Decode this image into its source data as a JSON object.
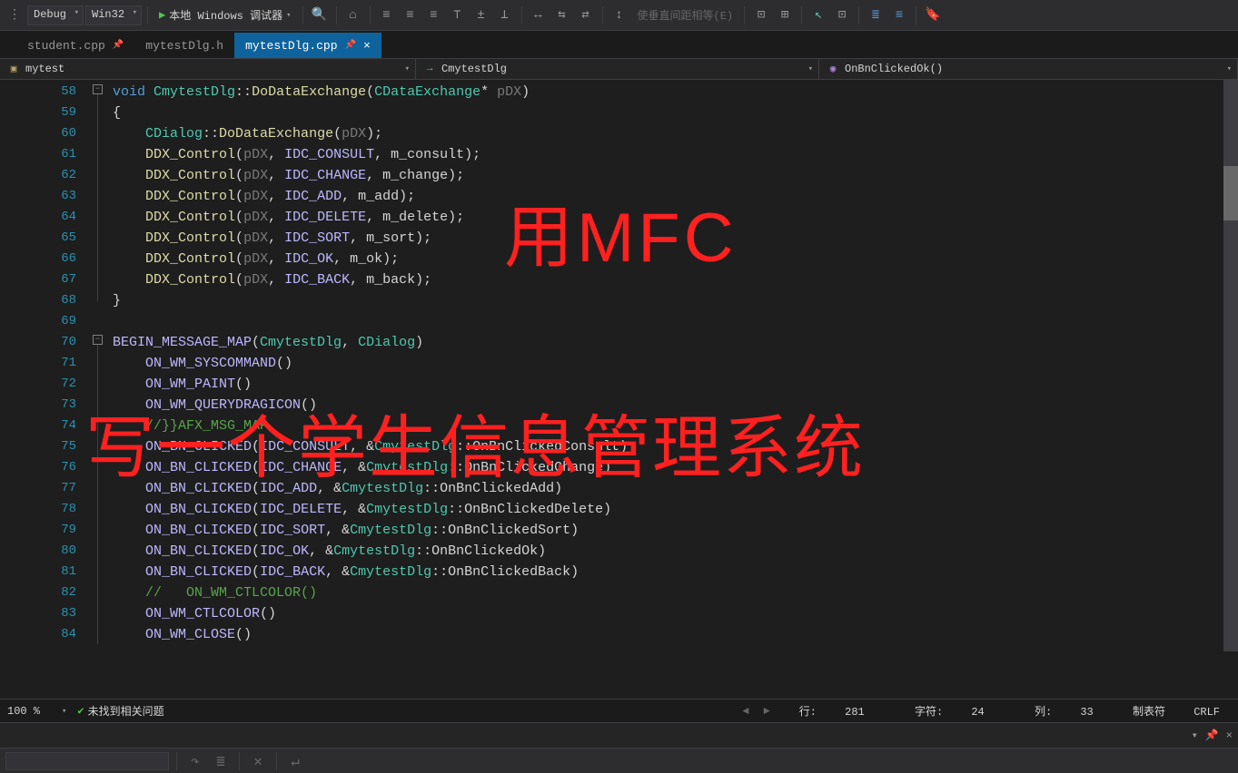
{
  "toolbar": {
    "config": "Debug",
    "platform": "Win32",
    "run_label": "本地 Windows 调试器",
    "disabled_label": "使垂直间距相等(E)"
  },
  "tabs": [
    {
      "label": "student.cpp",
      "active": false,
      "pinned": true
    },
    {
      "label": "mytestDlg.h",
      "active": false,
      "pinned": false
    },
    {
      "label": "mytestDlg.cpp",
      "active": true,
      "pinned": true
    }
  ],
  "context": {
    "project": "mytest",
    "class": "CmytestDlg",
    "function": "OnBnClickedOk()"
  },
  "line_numbers": [
    "58",
    "59",
    "60",
    "61",
    "62",
    "63",
    "64",
    "65",
    "66",
    "67",
    "68",
    "69",
    "70",
    "71",
    "72",
    "73",
    "74",
    "75",
    "76",
    "77",
    "78",
    "79",
    "80",
    "81",
    "82",
    "83",
    "84"
  ],
  "code_lines": [
    {
      "pre": "",
      "html": "<span class='k-blue'>void</span> <span class='k-type'>CmytestDlg</span><span class='k-white'>::</span><span class='k-fn'>DoDataExchange</span><span class='k-white'>(</span><span class='k-type'>CDataExchange</span><span class='k-white'>* </span><span class='k-gray'>pDX</span><span class='k-white'>)</span>"
    },
    {
      "pre": "",
      "html": "<span class='k-white'>{</span>"
    },
    {
      "pre": "    ",
      "html": "<span class='k-type'>CDialog</span><span class='k-white'>::</span><span class='k-fn'>DoDataExchange</span><span class='k-white'>(</span><span class='k-gray'>pDX</span><span class='k-white'>);</span>"
    },
    {
      "pre": "    ",
      "html": "<span class='k-fn'>DDX_Control</span><span class='k-white'>(</span><span class='k-gray'>pDX</span><span class='k-white'>, </span><span class='k-macro'>IDC_CONSULT</span><span class='k-white'>, m_consult);</span>"
    },
    {
      "pre": "    ",
      "html": "<span class='k-fn'>DDX_Control</span><span class='k-white'>(</span><span class='k-gray'>pDX</span><span class='k-white'>, </span><span class='k-macro'>IDC_CHANGE</span><span class='k-white'>, m_change);</span>"
    },
    {
      "pre": "    ",
      "html": "<span class='k-fn'>DDX_Control</span><span class='k-white'>(</span><span class='k-gray'>pDX</span><span class='k-white'>, </span><span class='k-macro'>IDC_ADD</span><span class='k-white'>, m_add);</span>"
    },
    {
      "pre": "    ",
      "html": "<span class='k-fn'>DDX_Control</span><span class='k-white'>(</span><span class='k-gray'>pDX</span><span class='k-white'>, </span><span class='k-macro'>IDC_DELETE</span><span class='k-white'>, m_delete);</span>"
    },
    {
      "pre": "    ",
      "html": "<span class='k-fn'>DDX_Control</span><span class='k-white'>(</span><span class='k-gray'>pDX</span><span class='k-white'>, </span><span class='k-macro'>IDC_SORT</span><span class='k-white'>, m_sort);</span>"
    },
    {
      "pre": "    ",
      "html": "<span class='k-fn'>DDX_Control</span><span class='k-white'>(</span><span class='k-gray'>pDX</span><span class='k-white'>, </span><span class='k-macro'>IDC_OK</span><span class='k-white'>, m_ok);</span>"
    },
    {
      "pre": "    ",
      "html": "<span class='k-fn'>DDX_Control</span><span class='k-white'>(</span><span class='k-gray'>pDX</span><span class='k-white'>, </span><span class='k-macro'>IDC_BACK</span><span class='k-white'>, m_back);</span>"
    },
    {
      "pre": "",
      "html": "<span class='k-white'>}</span>"
    },
    {
      "pre": "",
      "html": ""
    },
    {
      "pre": "",
      "html": "<span class='k-macro'>BEGIN_MESSAGE_MAP</span><span class='k-white'>(</span><span class='k-type'>CmytestDlg</span><span class='k-white'>, </span><span class='k-type'>CDialog</span><span class='k-white'>)</span>"
    },
    {
      "pre": "    ",
      "html": "<span class='k-macro'>ON_WM_SYSCOMMAND</span><span class='k-white'>()</span>"
    },
    {
      "pre": "    ",
      "html": "<span class='k-macro'>ON_WM_PAINT</span><span class='k-white'>()</span>"
    },
    {
      "pre": "    ",
      "html": "<span class='k-macro'>ON_WM_QUERYDRAGICON</span><span class='k-white'>()</span>"
    },
    {
      "pre": "    ",
      "html": "<span class='k-comment'>//}}AFX_MSG_MAP</span>"
    },
    {
      "pre": "    ",
      "html": "<span class='k-macro'>ON_BN_CLICKED</span><span class='k-white'>(</span><span class='k-macro'>IDC_CONSULT</span><span class='k-white'>, &</span><span class='k-type'>CmytestDlg</span><span class='k-white'>::OnBnClickedConsult)</span>"
    },
    {
      "pre": "    ",
      "html": "<span class='k-macro'>ON_BN_CLICKED</span><span class='k-white'>(</span><span class='k-macro'>IDC_CHANGE</span><span class='k-white'>, &</span><span class='k-type'>CmytestDlg</span><span class='k-white'>::OnBnClickedChange)</span>"
    },
    {
      "pre": "    ",
      "html": "<span class='k-macro'>ON_BN_CLICKED</span><span class='k-white'>(</span><span class='k-macro'>IDC_ADD</span><span class='k-white'>, &</span><span class='k-type'>CmytestDlg</span><span class='k-white'>::OnBnClickedAdd)</span>"
    },
    {
      "pre": "    ",
      "html": "<span class='k-macro'>ON_BN_CLICKED</span><span class='k-white'>(</span><span class='k-macro'>IDC_DELETE</span><span class='k-white'>, &</span><span class='k-type'>CmytestDlg</span><span class='k-white'>::OnBnClickedDelete)</span>"
    },
    {
      "pre": "    ",
      "html": "<span class='k-macro'>ON_BN_CLICKED</span><span class='k-white'>(</span><span class='k-macro'>IDC_SORT</span><span class='k-white'>, &</span><span class='k-type'>CmytestDlg</span><span class='k-white'>::OnBnClickedSort)</span>"
    },
    {
      "pre": "    ",
      "html": "<span class='k-macro'>ON_BN_CLICKED</span><span class='k-white'>(</span><span class='k-macro'>IDC_OK</span><span class='k-white'>, &</span><span class='k-type'>CmytestDlg</span><span class='k-white'>::OnBnClickedOk)</span>"
    },
    {
      "pre": "    ",
      "html": "<span class='k-macro'>ON_BN_CLICKED</span><span class='k-white'>(</span><span class='k-macro'>IDC_BACK</span><span class='k-white'>, &</span><span class='k-type'>CmytestDlg</span><span class='k-white'>::OnBnClickedBack)</span>"
    },
    {
      "pre": "    ",
      "html": "<span class='k-comment'>//   ON_WM_CTLCOLOR()</span>"
    },
    {
      "pre": "    ",
      "html": "<span class='k-macro'>ON_WM_CTLCOLOR</span><span class='k-white'>()</span>"
    },
    {
      "pre": "    ",
      "html": "<span class='k-macro'>ON_WM_CLOSE</span><span class='k-white'>()</span>"
    }
  ],
  "overlay": {
    "line1": "用MFC",
    "line2": "写一个学生信息管理系统"
  },
  "status": {
    "zoom": "100 %",
    "issues": "未找到相关问题",
    "line_label": "行:",
    "line": "281",
    "char_label": "字符:",
    "char": "24",
    "col_label": "列:",
    "col": "33",
    "tabs": "制表符",
    "eol": "CRLF"
  }
}
